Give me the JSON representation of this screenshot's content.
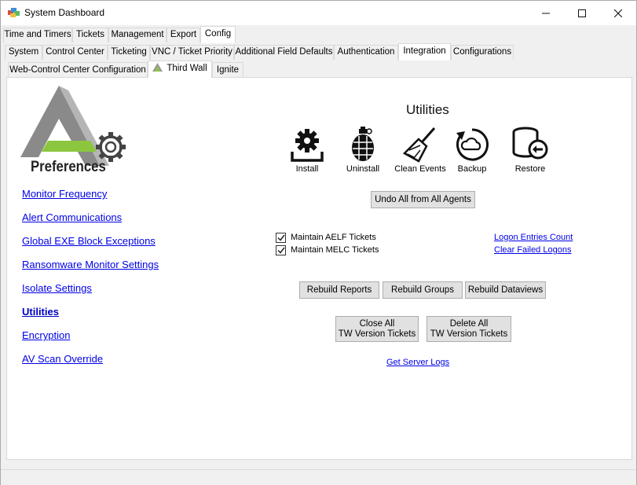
{
  "window": {
    "title": "System Dashboard"
  },
  "main_tabs": [
    "Time and Timers",
    "Tickets",
    "Management",
    "Export",
    "Config"
  ],
  "config_tabs": [
    "System",
    "Control Center",
    "Ticketing",
    "VNC / Ticket Priority",
    "Additional Field Defaults",
    "Authentication",
    "Integration",
    "Configurations"
  ],
  "integration_tabs": [
    "Web-Control Center Configuration",
    "Third Wall",
    "Ignite"
  ],
  "logo": {
    "label": "Preferences"
  },
  "nav": [
    "Monitor Frequency",
    "Alert Communications",
    "Global EXE Block Exceptions",
    "Ransomware Monitor Settings",
    "Isolate Settings",
    "Utilities",
    "Encryption",
    "AV Scan Override"
  ],
  "utilities": {
    "heading": "Utilities",
    "tools": [
      {
        "label": "Install",
        "icon": "install-icon"
      },
      {
        "label": "Uninstall",
        "icon": "grenade-icon"
      },
      {
        "label": "Clean Events",
        "icon": "broom-icon"
      },
      {
        "label": "Backup",
        "icon": "backup-icon"
      },
      {
        "label": "Restore",
        "icon": "restore-icon"
      }
    ],
    "undo_button": "Undo All from All Agents",
    "checkboxes": [
      {
        "label": "Maintain AELF Tickets",
        "checked": true
      },
      {
        "label": "Maintain MELC Tickets",
        "checked": true
      }
    ],
    "links": [
      "Logon Entries Count",
      "Clear Failed Logons"
    ],
    "rebuild_buttons": [
      "Rebuild Reports",
      "Rebuild Groups",
      "Rebuild Dataviews"
    ],
    "close_all": {
      "line1": "Close All",
      "line2": "TW Version Tickets"
    },
    "delete_all": {
      "line1": "Delete All",
      "line2": "TW Version Tickets"
    },
    "server_logs": "Get Server Logs"
  },
  "colors": {
    "link": "#0000e6",
    "logo_green": "#8cc63f",
    "logo_gray": "#8a8a8a"
  }
}
